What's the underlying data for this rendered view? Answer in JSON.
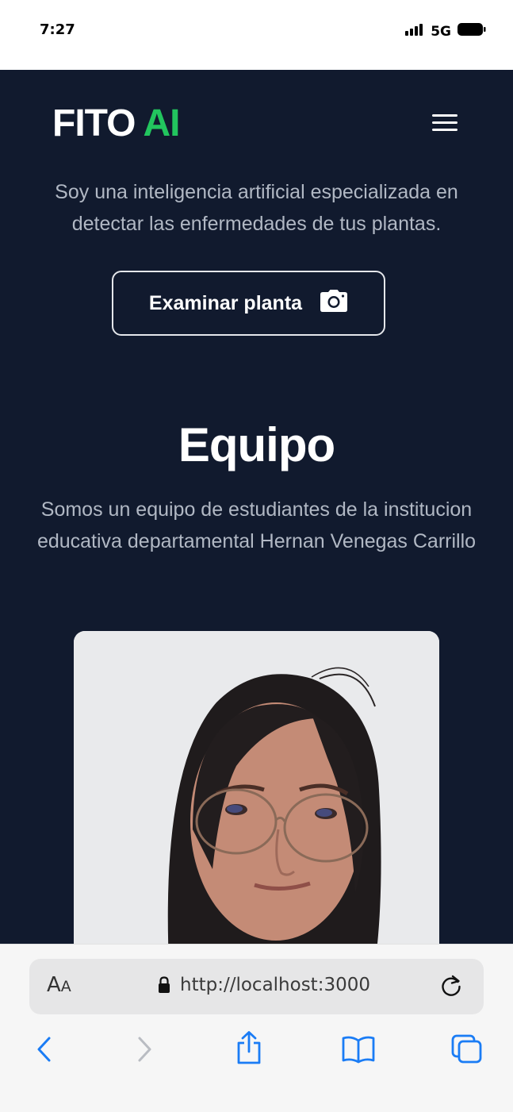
{
  "status_bar": {
    "time": "7:27",
    "network": "5G"
  },
  "header": {
    "logo_main": "FITO",
    "logo_accent": "AI",
    "accent_color": "#22c55e",
    "menu_icon": "hamburger-menu-icon"
  },
  "hero": {
    "intro": "Soy una inteligencia artificial especializada en detectar las enfermedades de tus plantas.",
    "button_label": "Examinar planta",
    "button_icon": "camera-icon"
  },
  "team": {
    "title": "Equipo",
    "description": "Somos un equipo de estudiantes de la institucion educativa departamental Hernan Venegas Carrillo"
  },
  "safari": {
    "text_size_label_big": "A",
    "text_size_label_small": "A",
    "url": "http://localhost:3000"
  },
  "colors": {
    "page_background": "#111a2e",
    "body_text": "#b1b8c4"
  }
}
